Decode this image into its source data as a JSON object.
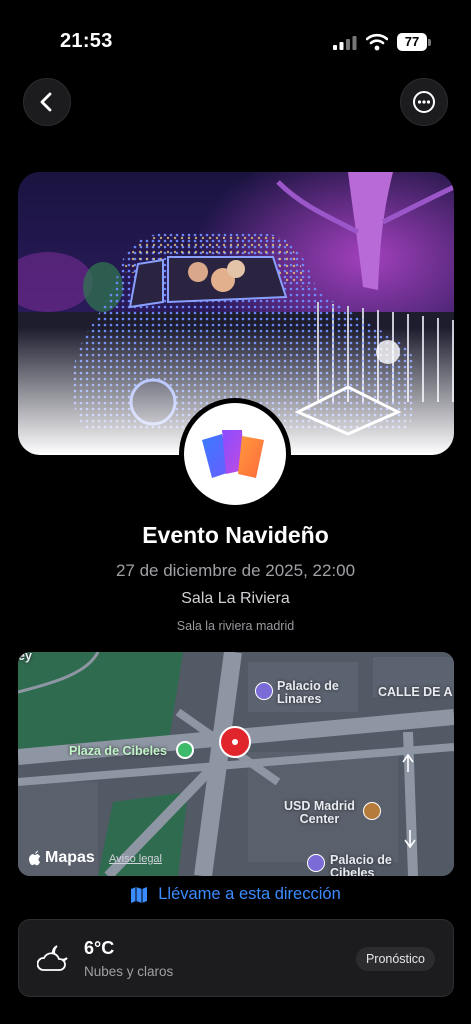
{
  "status_bar": {
    "time": "21:53",
    "battery": "77"
  },
  "nav": {
    "back_icon": "chevron-left-icon",
    "more_icon": "ellipsis-icon"
  },
  "event": {
    "title": "Evento Navideño",
    "datetime": "27 de diciembre de 2025, 22:00",
    "venue": "Sala La Riviera",
    "address": "Sala la riviera madrid"
  },
  "map": {
    "places": {
      "palacio_linares": "Palacio de\nLinares",
      "calle": "CALLE DE A",
      "plaza_cibeles": "Plaza de Cibeles",
      "usd_madrid": "USD Madrid\nCenter",
      "palacio_cibeles": "Palacio de\nCibeles",
      "corner": "ey"
    },
    "brand": "Mapas",
    "legal": "Aviso legal"
  },
  "directions_label": "Llévame a esta dirección",
  "weather": {
    "temperature": "6°C",
    "condition": "Nubes y claros",
    "forecast_button": "Pronóstico"
  },
  "colors": {
    "link": "#3b8cff",
    "pin": "#e0252c"
  }
}
